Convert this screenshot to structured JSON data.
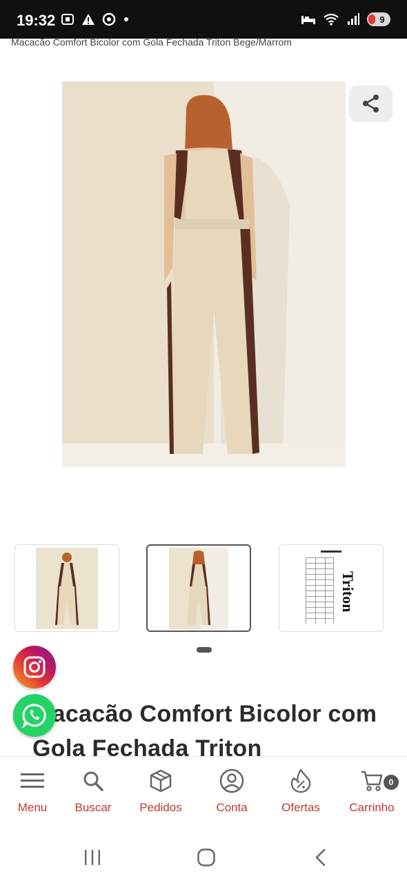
{
  "status_bar": {
    "time": "19:32",
    "battery_level": "9"
  },
  "page": {
    "breadcrumb_title": "Macacão Comfort Bicolor com Gola Fechada Triton Bege/Marrom",
    "product_title": "Macacão Comfort Bicolor com Gola Fechada Triton"
  },
  "gallery": {
    "thumbnails": [
      {
        "kind": "photo-front",
        "selected": false
      },
      {
        "kind": "photo-back",
        "selected": true
      },
      {
        "kind": "size-chart",
        "selected": false
      }
    ],
    "brand_logo_text": "Triton"
  },
  "bottom_nav": {
    "items": [
      {
        "label": "Menu",
        "icon": "hamburger-icon"
      },
      {
        "label": "Buscar",
        "icon": "search-icon"
      },
      {
        "label": "Pedidos",
        "icon": "box-icon"
      },
      {
        "label": "Conta",
        "icon": "user-icon"
      },
      {
        "label": "Ofertas",
        "icon": "discount-flame-icon"
      },
      {
        "label": "Carrinho",
        "icon": "cart-icon"
      }
    ],
    "cart_count": "0"
  },
  "colors": {
    "accent": "#c0392b",
    "whatsapp": "#25d366",
    "garment_beige": "#e6d7bd",
    "garment_brown": "#5a2f22"
  }
}
